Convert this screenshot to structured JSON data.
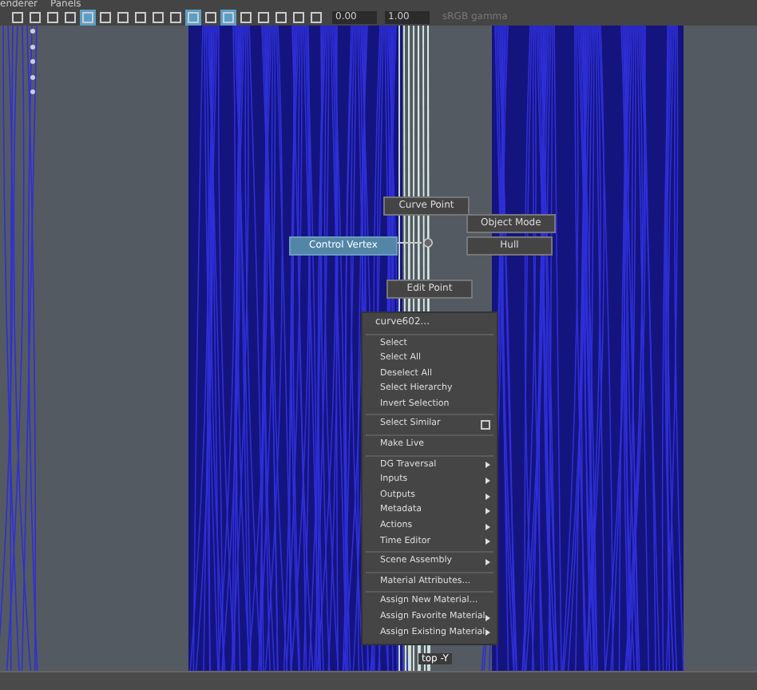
{
  "menu_bar": {
    "items": [
      "enderer",
      "Panels"
    ]
  },
  "toolbar": {
    "buttons": [
      {
        "selected": false
      },
      {
        "selected": false
      },
      {
        "selected": false
      },
      {
        "selected": false
      },
      {
        "selected": true
      },
      {
        "selected": false
      },
      {
        "selected": false
      },
      {
        "selected": false
      },
      {
        "selected": false
      },
      {
        "selected": false
      },
      {
        "selected": true
      },
      {
        "selected": false
      },
      {
        "selected": true
      },
      {
        "selected": false
      },
      {
        "selected": false
      },
      {
        "selected": false
      },
      {
        "selected": false
      },
      {
        "selected": false
      }
    ],
    "exposure": "0.00",
    "gamma": "1.00",
    "color_space": {
      "value": "sRGB gamma",
      "disabled": true
    }
  },
  "marking_menu": [
    {
      "label": "Curve Point",
      "selected": false
    },
    {
      "label": "Object Mode",
      "selected": false
    },
    {
      "label": "Control Vertex",
      "selected": true
    },
    {
      "label": "Hull",
      "selected": false
    },
    {
      "label": "Edit Point",
      "selected": false
    }
  ],
  "context_menu": {
    "title": "curve602...",
    "groups": [
      [
        {
          "label": "Select",
          "kind": "action"
        },
        {
          "label": "Select All",
          "kind": "action"
        },
        {
          "label": "Deselect All",
          "kind": "action"
        },
        {
          "label": "Select Hierarchy",
          "kind": "action"
        },
        {
          "label": "Invert Selection",
          "kind": "action"
        }
      ],
      [
        {
          "label": "Select Similar",
          "kind": "option"
        }
      ],
      [
        {
          "label": "Make Live",
          "kind": "action"
        }
      ],
      [
        {
          "label": "DG Traversal",
          "kind": "submenu"
        },
        {
          "label": "Inputs",
          "kind": "submenu"
        },
        {
          "label": "Outputs",
          "kind": "submenu"
        },
        {
          "label": "Metadata",
          "kind": "submenu"
        },
        {
          "label": "Actions",
          "kind": "submenu"
        },
        {
          "label": "Time Editor",
          "kind": "submenu"
        }
      ],
      [
        {
          "label": "Scene Assembly",
          "kind": "submenu"
        }
      ],
      [
        {
          "label": "Material Attributes...",
          "kind": "action"
        }
      ],
      [
        {
          "label": "Assign New Material...",
          "kind": "action"
        },
        {
          "label": "Assign Favorite Material",
          "kind": "submenu"
        },
        {
          "label": "Assign Existing Material",
          "kind": "submenu"
        }
      ]
    ]
  },
  "camera_label": "top -Y"
}
